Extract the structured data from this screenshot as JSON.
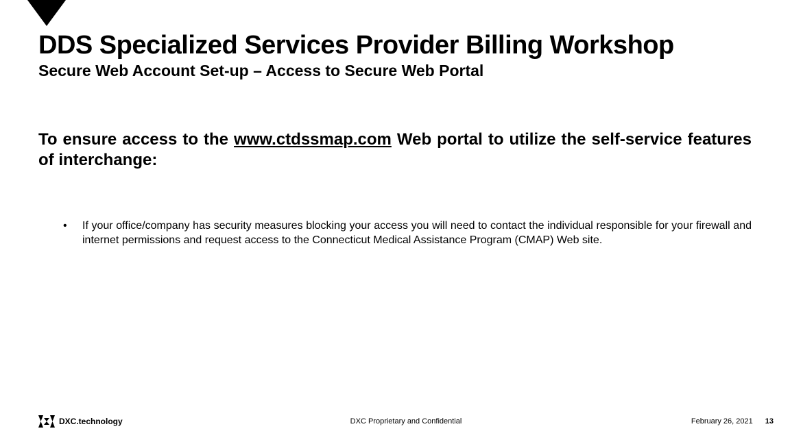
{
  "header": {
    "title": "DDS Specialized  Services Provider Billing Workshop",
    "subtitle": "Secure Web Account Set-up – Access to Secure Web Portal"
  },
  "intro": {
    "prefix": "To ensure access to the ",
    "link": "www.ctdssmap.com",
    "suffix": " Web portal to utilize the self-service features of interchange:"
  },
  "bullet": {
    "marker": "•",
    "text": "If your office/company has security measures blocking your access you will need to contact the individual responsible for your firewall and internet permissions and request access to the Connecticut Medical Assistance Program (CMAP) Web site."
  },
  "footer": {
    "logo_text": "DXC.technology",
    "center": "DXC Proprietary and Confidential",
    "date": "February 26, 2021",
    "page": "13"
  }
}
